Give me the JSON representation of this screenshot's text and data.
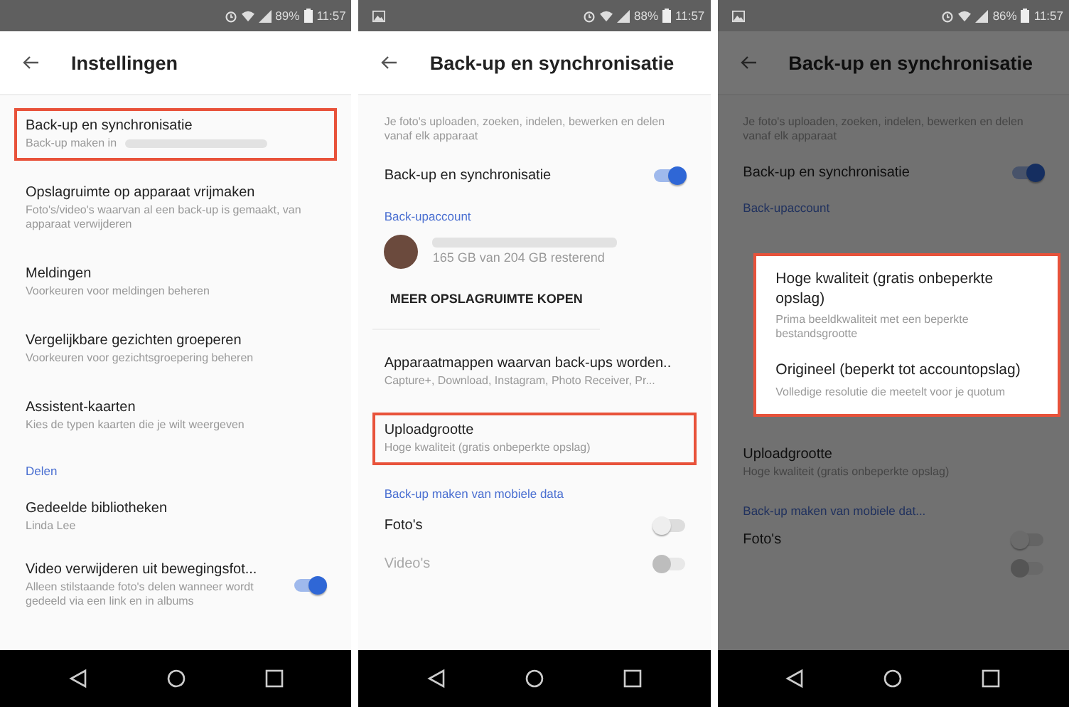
{
  "screens": [
    {
      "status_bar": {
        "notification_icon": false,
        "battery": "89%",
        "time": "11:57"
      },
      "header": {
        "title": "Instellingen"
      },
      "dimmed": false,
      "items": [
        {
          "kind": "setting",
          "title": "Back-up en synchronisatie",
          "subtitle": "Back-up maken in",
          "redacted": true,
          "highlighted": true
        },
        {
          "kind": "setting",
          "title": "Opslagruimte op apparaat vrijmaken",
          "subtitle": "Foto's/video's waarvan al een back-up is gemaakt, van apparaat verwijderen",
          "highlighted": false
        },
        {
          "kind": "setting",
          "title": "Meldingen",
          "subtitle": "Voorkeuren voor meldingen beheren",
          "highlighted": false
        },
        {
          "kind": "setting",
          "title": "Vergelijkbare gezichten groeperen",
          "subtitle": "Voorkeuren voor gezichtsgroepering beheren",
          "highlighted": false
        },
        {
          "kind": "setting",
          "title": "Assistent-kaarten",
          "subtitle": "Kies de typen kaarten die je wilt weergeven",
          "highlighted": false
        },
        {
          "kind": "section",
          "title": "Delen"
        },
        {
          "kind": "setting",
          "title": "Gedeelde bibliotheken",
          "subtitle": "Linda Lee",
          "highlighted": false
        },
        {
          "kind": "toggle",
          "title": "Video verwijderen uit bewegingsfot...",
          "subtitle": "Alleen stilstaande foto's delen wanneer wordt gedeeld via een link en in albums",
          "on": true,
          "disabled": false
        }
      ]
    },
    {
      "status_bar": {
        "notification_icon": true,
        "battery": "88%",
        "time": "11:57"
      },
      "header": {
        "title": "Back-up en synchronisatie"
      },
      "dimmed": false,
      "items": [
        {
          "kind": "intro",
          "title": "Je foto's uploaden, zoeken, indelen, bewerken en delen vanaf elk apparaat"
        },
        {
          "kind": "toggle",
          "title": "Back-up en synchronisatie",
          "on": true,
          "disabled": false
        },
        {
          "kind": "section",
          "title": "Back-upaccount"
        },
        {
          "kind": "account",
          "subtitle": "165 GB van 204 GB resterend",
          "redacted": true
        },
        {
          "kind": "button",
          "title": "MEER OPSLAGRUIMTE KOPEN"
        },
        {
          "kind": "setting",
          "title": "Apparaatmappen waarvan back-ups worden..",
          "subtitle": "Capture+, Download, Instagram, Photo Receiver, Pr...",
          "highlighted": false
        },
        {
          "kind": "setting",
          "title": "Uploadgrootte",
          "subtitle": "Hoge kwaliteit (gratis onbeperkte opslag)",
          "highlighted": true
        },
        {
          "kind": "section",
          "title": "Back-up maken van mobiele data"
        },
        {
          "kind": "toggle",
          "title": "Foto's",
          "on": false,
          "disabled": false
        },
        {
          "kind": "toggle",
          "title": "Video's",
          "on": false,
          "disabled": true
        }
      ]
    },
    {
      "status_bar": {
        "notification_icon": true,
        "battery": "86%",
        "time": "11:57"
      },
      "header": {
        "title": "Back-up en synchronisatie"
      },
      "dimmed": true,
      "items": [
        {
          "kind": "intro",
          "title": "Je foto's uploaden, zoeken, indelen, bewerken en delen vanaf elk apparaat"
        },
        {
          "kind": "toggle",
          "title": "Back-up en synchronisatie",
          "on": true,
          "disabled": false
        },
        {
          "kind": "section",
          "title": "Back-upaccount"
        },
        {
          "kind": "spacer"
        },
        {
          "kind": "setting",
          "title": "Uploadgrootte",
          "subtitle": "Hoge kwaliteit (gratis onbeperkte opslag)",
          "highlighted": false
        },
        {
          "kind": "section",
          "title": "Back-up maken van mobiele dat..."
        },
        {
          "kind": "toggle",
          "title": "Foto's",
          "on": false,
          "disabled": false
        },
        {
          "kind": "toggle",
          "on": false,
          "disabled": true
        }
      ],
      "dialog": {
        "highlighted": true,
        "options": [
          {
            "title": "Hoge kwaliteit (gratis onbeperkte opslag)",
            "subtitle": "Prima beeldkwaliteit met een beperkte bestandsgrootte"
          },
          {
            "title": "Origineel (beperkt tot accountopslag)",
            "subtitle": "Volledige resolutie die meetelt voor je quotum"
          }
        ]
      }
    }
  ]
}
